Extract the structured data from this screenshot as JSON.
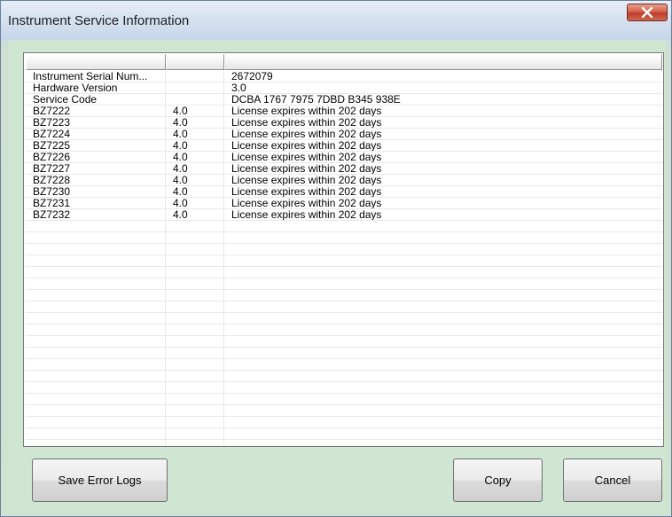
{
  "window": {
    "title": "Instrument Service Information",
    "close_glyph": "✕"
  },
  "table": {
    "columns": [
      "",
      "",
      ""
    ],
    "rows": [
      [
        "Instrument Serial Num...",
        "",
        "2672079"
      ],
      [
        "Hardware Version",
        "",
        "3.0"
      ],
      [
        "Service Code",
        "",
        "DCBA 1767 7975 7DBD B345 938E"
      ],
      [
        "BZ7222",
        "4.0",
        "License expires within 202 days"
      ],
      [
        "BZ7223",
        "4.0",
        "License expires within 202 days"
      ],
      [
        "BZ7224",
        "4.0",
        "License expires within 202 days"
      ],
      [
        "BZ7225",
        "4.0",
        "License expires within 202 days"
      ],
      [
        "BZ7226",
        "4.0",
        "License expires within 202 days"
      ],
      [
        "BZ7227",
        "4.0",
        "License expires within 202 days"
      ],
      [
        "BZ7228",
        "4.0",
        "License expires within 202 days"
      ],
      [
        "BZ7230",
        "4.0",
        "License expires within 202 days"
      ],
      [
        "BZ7231",
        "4.0",
        "License expires within 202 days"
      ],
      [
        "BZ7232",
        "4.0",
        "License expires within 202 days"
      ],
      [
        "",
        "",
        ""
      ],
      [
        "",
        "",
        ""
      ],
      [
        "",
        "",
        ""
      ],
      [
        "",
        "",
        ""
      ],
      [
        "",
        "",
        ""
      ],
      [
        "",
        "",
        ""
      ],
      [
        "",
        "",
        ""
      ],
      [
        "",
        "",
        ""
      ],
      [
        "",
        "",
        ""
      ],
      [
        "",
        "",
        ""
      ],
      [
        "",
        "",
        ""
      ],
      [
        "",
        "",
        ""
      ],
      [
        "",
        "",
        ""
      ],
      [
        "",
        "",
        ""
      ],
      [
        "",
        "",
        ""
      ],
      [
        "",
        "",
        ""
      ],
      [
        "",
        "",
        ""
      ],
      [
        "",
        "",
        ""
      ],
      [
        "",
        "",
        ""
      ],
      [
        "",
        "",
        ""
      ]
    ]
  },
  "buttons": {
    "save_error_logs": "Save Error Logs",
    "copy": "Copy",
    "cancel": "Cancel"
  },
  "icons": {
    "close": "close-icon"
  }
}
